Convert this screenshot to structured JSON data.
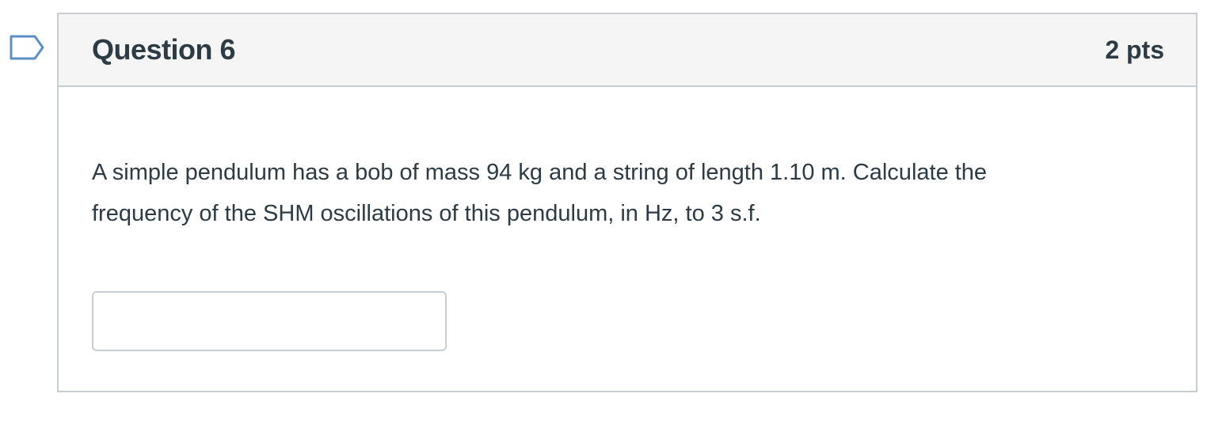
{
  "question": {
    "title": "Question 6",
    "points": "2 pts",
    "text": "A simple pendulum has a bob of mass 94 kg and a string of length 1.10 m. Calculate the frequency of the SHM oscillations of this pendulum, in Hz, to 3 s.f.",
    "answer": {
      "value": "",
      "placeholder": ""
    }
  },
  "flag": {
    "icon": "flag-icon",
    "color": "#5b8fc7"
  },
  "colors": {
    "header_bg": "#f5f5f5",
    "border": "#c7cdd1",
    "text": "#2d3b45"
  }
}
